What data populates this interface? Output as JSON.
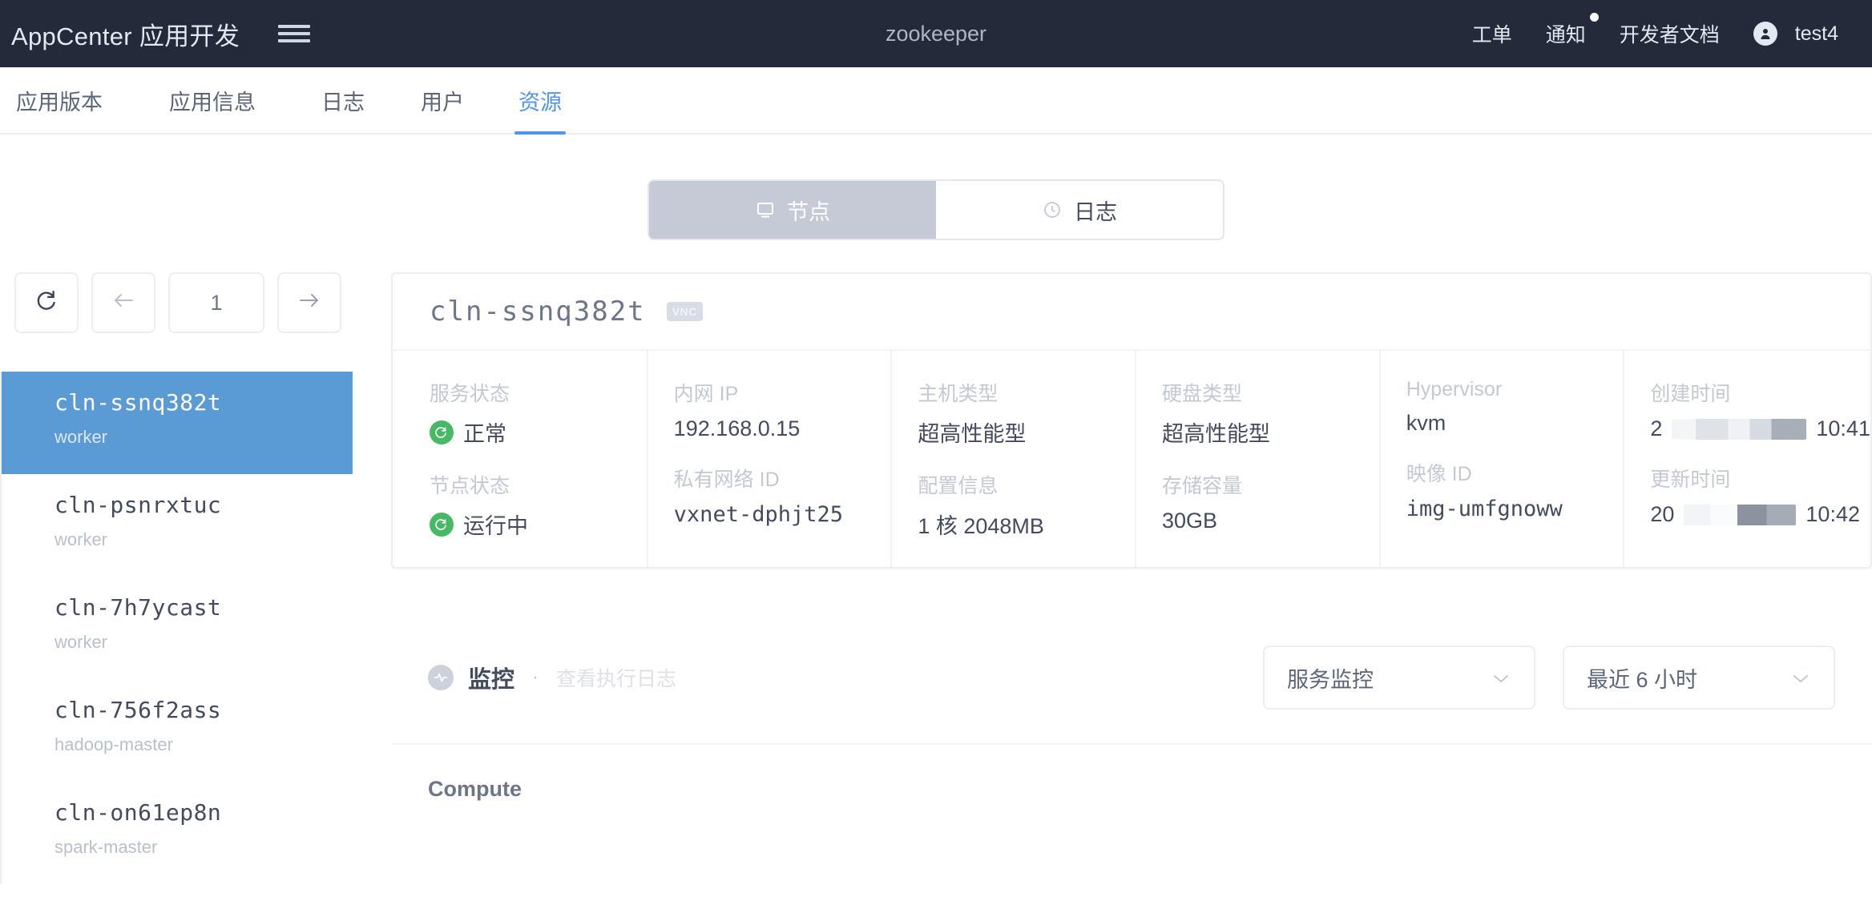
{
  "header": {
    "brand": "AppCenter 应用开发",
    "menu_icon": "hamburger-icon",
    "app_title": "zookeeper",
    "nav": [
      {
        "label": "工单",
        "badge": false
      },
      {
        "label": "通知",
        "badge": true
      },
      {
        "label": "开发者文档",
        "badge": false
      }
    ],
    "user": {
      "name": "test4",
      "icon": "user-icon"
    }
  },
  "tabs": [
    {
      "label": "应用版本",
      "active": false
    },
    {
      "label": "应用信息",
      "active": false
    },
    {
      "label": "日志",
      "active": false
    },
    {
      "label": "用户",
      "active": false
    },
    {
      "label": "资源",
      "active": true
    }
  ],
  "segmented": {
    "selected": "节点",
    "options": [
      {
        "label": "节点",
        "icon": "monitor-icon",
        "selected": true
      },
      {
        "label": "日志",
        "icon": "clock-icon",
        "selected": false
      }
    ]
  },
  "pager": {
    "refresh_icon": "refresh-icon",
    "prev_icon": "arrow-left-icon",
    "page": "1",
    "next_icon": "arrow-right-icon"
  },
  "nodes": [
    {
      "name": "cln-ssnq382t",
      "role": "worker",
      "selected": true
    },
    {
      "name": "cln-psnrxtuc",
      "role": "worker",
      "selected": false
    },
    {
      "name": "cln-7h7ycast",
      "role": "worker",
      "selected": false
    },
    {
      "name": "cln-756f2ass",
      "role": "hadoop-master",
      "selected": false
    },
    {
      "name": "cln-on61ep8n",
      "role": "spark-master",
      "selected": false
    }
  ],
  "detail": {
    "name": "cln-ssnq382t",
    "badge": "VNC",
    "fields": [
      {
        "label": "服务状态",
        "value": "正常",
        "status": true
      },
      {
        "label": "节点状态",
        "value": "运行中",
        "status": true
      },
      {
        "label": "内网 IP",
        "value": "192.168.0.15",
        "status": false
      },
      {
        "label": "私有网络 ID",
        "value": "vxnet-dphjt25",
        "status": false
      },
      {
        "label": "主机类型",
        "value": "超高性能型",
        "status": false
      },
      {
        "label": "配置信息",
        "value": "1 核 2048MB",
        "status": false
      },
      {
        "label": "硬盘类型",
        "value": "超高性能型",
        "status": false
      },
      {
        "label": "存储容量",
        "value": "30GB",
        "status": false
      },
      {
        "label": "Hypervisor",
        "value": "kvm",
        "status": false
      },
      {
        "label": "映像 ID",
        "value": "img-umfgnoww",
        "status": false
      },
      {
        "label": "创建时间",
        "value_prefix": "2",
        "value_suffix": "10:41",
        "redacted": true
      },
      {
        "label": "更新时间",
        "value_prefix": "20",
        "value_suffix": "10:42",
        "redacted": true
      }
    ]
  },
  "monitor": {
    "icon": "pulse-icon",
    "title": "监控",
    "separator": "·",
    "link": "查看执行日志",
    "metric_select": {
      "value": "服务监控",
      "chevron": "chevron-down-icon"
    },
    "range_select": {
      "value": "最近 6 小时",
      "chevron": "chevron-down-icon"
    },
    "section_label": "Compute"
  },
  "colors": {
    "header_bg": "#252a3a",
    "accent": "#4f94f0",
    "selected_node": "#5b9bd5",
    "status_green": "#46b964",
    "segment_active": "#c5cad6"
  }
}
